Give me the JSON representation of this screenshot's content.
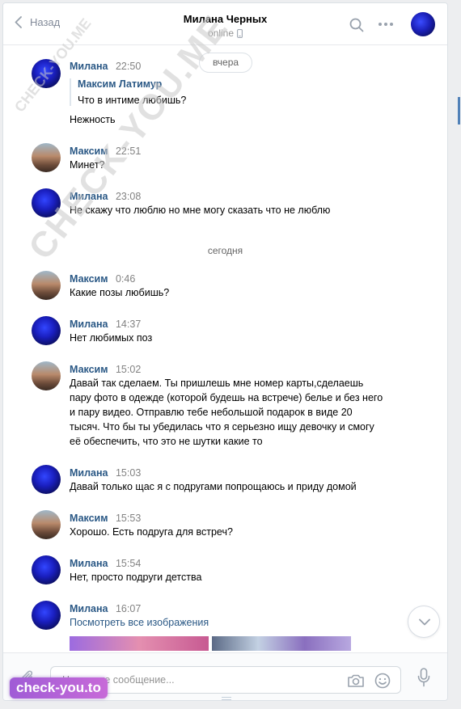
{
  "header": {
    "back_label": "Назад",
    "title": "Милана Черных",
    "status": "online"
  },
  "day_separators": {
    "yesterday": "вчера",
    "today": "сегодня"
  },
  "messages": [
    {
      "author": "Милана",
      "time": "22:50",
      "quote_author": "Максим Латимур",
      "quote_text": "Что в интиме любишь?",
      "text": "Нежность"
    },
    {
      "author": "Максим",
      "time": "22:51",
      "text": "Минет?"
    },
    {
      "author": "Милана",
      "time": "23:08",
      "text": "Не скажу что люблю но мне могу сказать что не люблю"
    },
    {
      "author": "Максим",
      "time": "0:46",
      "text": "Какие позы любишь?"
    },
    {
      "author": "Милана",
      "time": "14:37",
      "text": "Нет любимых поз"
    },
    {
      "author": "Максим",
      "time": "15:02",
      "text": "Давай так сделаем. Ты пришлешь мне номер карты,сделаешь пару фото в одежде (которой будешь на встрече) белье и без него и пару видео. Отправлю тебе небольшой подарок в виде 20 тысяч. Что бы ты убедилась что я серьезно ищу девочку и смогу её обеспечить, что это не шутки какие то"
    },
    {
      "author": "Милана",
      "time": "15:03",
      "text": "Давай только щас я с подругами попрощаюсь и приду домой"
    },
    {
      "author": "Максим",
      "time": "15:53",
      "text": "Хорошо. Есть подруга для встреч?"
    },
    {
      "author": "Милана",
      "time": "15:54",
      "text": "Нет, просто подруги детства"
    },
    {
      "author": "Милана",
      "time": "16:07",
      "text": "Посмотреть все изображения"
    }
  ],
  "composer": {
    "placeholder": "Напишите сообщение..."
  },
  "watermarks": {
    "small": "CHECK-YOU.ME",
    "large": "CHECK-YOU.ME",
    "badge": "check-you.to"
  }
}
